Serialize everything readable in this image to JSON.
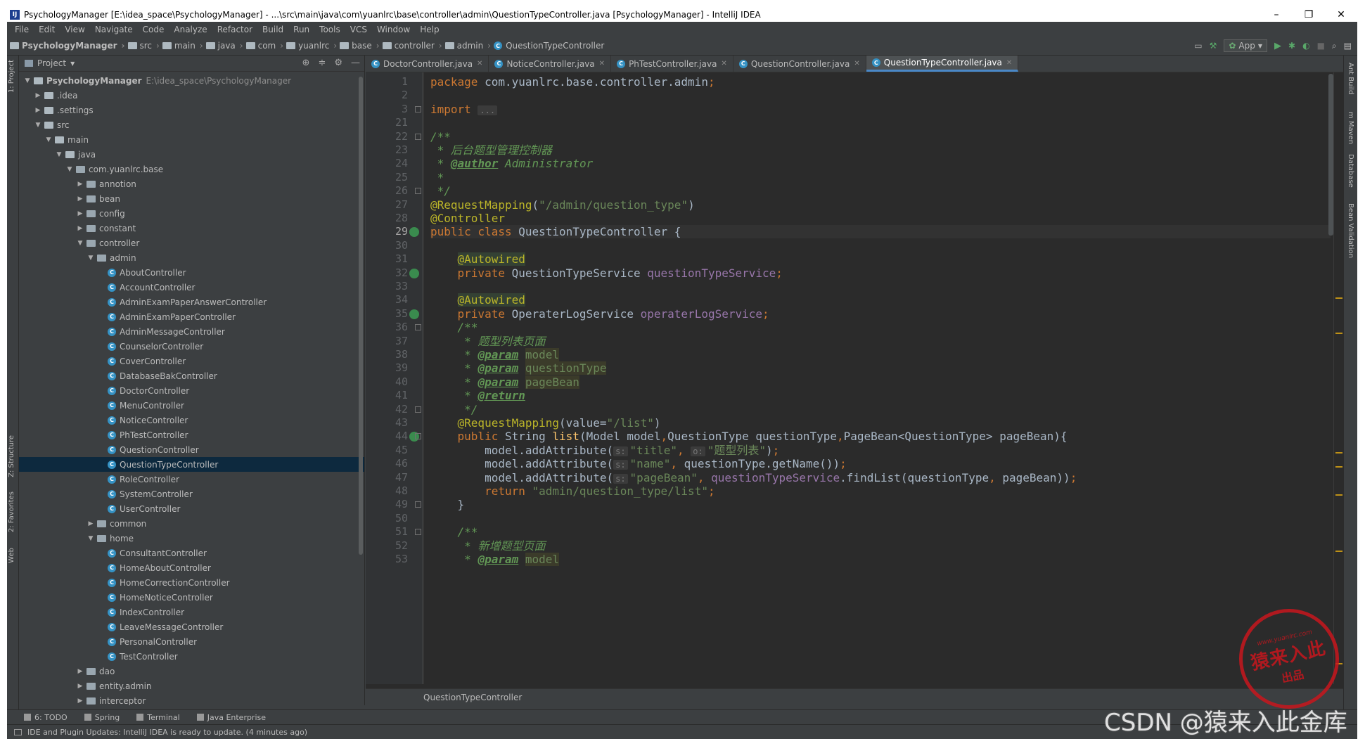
{
  "window": {
    "title": "PsychologyManager [E:\\idea_space\\PsychologyManager] - ...\\src\\main\\java\\com\\yuanlrc\\base\\controller\\admin\\QuestionTypeController.java [PsychologyManager] - IntelliJ IDEA",
    "controls": [
      "–",
      "❐",
      "✕"
    ]
  },
  "menu": [
    "File",
    "Edit",
    "View",
    "Navigate",
    "Code",
    "Analyze",
    "Refactor",
    "Build",
    "Run",
    "Tools",
    "VCS",
    "Window",
    "Help"
  ],
  "navbar": {
    "crumbs": [
      "PsychologyManager",
      "src",
      "main",
      "java",
      "com",
      "yuanlrc",
      "base",
      "controller",
      "admin"
    ],
    "current": "QuestionTypeController",
    "run_config": "App"
  },
  "left_strip": [
    "1: Project",
    "Z: Structure",
    "2: Favorites",
    "Web"
  ],
  "right_strip": [
    "Ant Build",
    "m Maven",
    "Database",
    "Bean Validation"
  ],
  "project": {
    "header": "Project",
    "tree": [
      {
        "label": "PsychologyManager",
        "path": "E:\\idea_space\\PsychologyManager",
        "depth": 0,
        "kind": "project",
        "open": true
      },
      {
        "label": ".idea",
        "depth": 1,
        "kind": "folder",
        "open": false
      },
      {
        "label": ".settings",
        "depth": 1,
        "kind": "folder",
        "open": false
      },
      {
        "label": "src",
        "depth": 1,
        "kind": "folder",
        "open": true
      },
      {
        "label": "main",
        "depth": 2,
        "kind": "folder",
        "open": true
      },
      {
        "label": "java",
        "depth": 3,
        "kind": "folder",
        "open": true
      },
      {
        "label": "com.yuanlrc.base",
        "depth": 4,
        "kind": "pkg",
        "open": true
      },
      {
        "label": "annotion",
        "depth": 5,
        "kind": "pkg",
        "open": false
      },
      {
        "label": "bean",
        "depth": 5,
        "kind": "pkg",
        "open": false
      },
      {
        "label": "config",
        "depth": 5,
        "kind": "pkg",
        "open": false
      },
      {
        "label": "constant",
        "depth": 5,
        "kind": "pkg",
        "open": false
      },
      {
        "label": "controller",
        "depth": 5,
        "kind": "pkg",
        "open": true
      },
      {
        "label": "admin",
        "depth": 6,
        "kind": "pkg",
        "open": true
      },
      {
        "label": "AboutController",
        "depth": 7,
        "kind": "class"
      },
      {
        "label": "AccountController",
        "depth": 7,
        "kind": "class"
      },
      {
        "label": "AdminExamPaperAnswerController",
        "depth": 7,
        "kind": "class"
      },
      {
        "label": "AdminExamPaperController",
        "depth": 7,
        "kind": "class"
      },
      {
        "label": "AdminMessageController",
        "depth": 7,
        "kind": "class"
      },
      {
        "label": "CounselorController",
        "depth": 7,
        "kind": "class"
      },
      {
        "label": "CoverController",
        "depth": 7,
        "kind": "class"
      },
      {
        "label": "DatabaseBakController",
        "depth": 7,
        "kind": "class"
      },
      {
        "label": "DoctorController",
        "depth": 7,
        "kind": "class"
      },
      {
        "label": "MenuController",
        "depth": 7,
        "kind": "class"
      },
      {
        "label": "NoticeController",
        "depth": 7,
        "kind": "class"
      },
      {
        "label": "PhTestController",
        "depth": 7,
        "kind": "class"
      },
      {
        "label": "QuestionController",
        "depth": 7,
        "kind": "class"
      },
      {
        "label": "QuestionTypeController",
        "depth": 7,
        "kind": "class",
        "selected": true
      },
      {
        "label": "RoleController",
        "depth": 7,
        "kind": "class"
      },
      {
        "label": "SystemController",
        "depth": 7,
        "kind": "class"
      },
      {
        "label": "UserController",
        "depth": 7,
        "kind": "class"
      },
      {
        "label": "common",
        "depth": 6,
        "kind": "pkg",
        "open": false
      },
      {
        "label": "home",
        "depth": 6,
        "kind": "pkg",
        "open": true
      },
      {
        "label": "ConsultantController",
        "depth": 7,
        "kind": "class"
      },
      {
        "label": "HomeAboutController",
        "depth": 7,
        "kind": "class"
      },
      {
        "label": "HomeCorrectionController",
        "depth": 7,
        "kind": "class"
      },
      {
        "label": "HomeNoticeController",
        "depth": 7,
        "kind": "class"
      },
      {
        "label": "IndexController",
        "depth": 7,
        "kind": "class"
      },
      {
        "label": "LeaveMessageController",
        "depth": 7,
        "kind": "class"
      },
      {
        "label": "PersonalController",
        "depth": 7,
        "kind": "class"
      },
      {
        "label": "TestController",
        "depth": 7,
        "kind": "class"
      },
      {
        "label": "dao",
        "depth": 5,
        "kind": "pkg",
        "open": false
      },
      {
        "label": "entity.admin",
        "depth": 5,
        "kind": "pkg",
        "open": false
      },
      {
        "label": "interceptor",
        "depth": 5,
        "kind": "pkg",
        "open": false
      }
    ]
  },
  "editor": {
    "tabs": [
      {
        "label": "DoctorController.java",
        "active": false
      },
      {
        "label": "NoticeController.java",
        "active": false
      },
      {
        "label": "PhTestController.java",
        "active": false
      },
      {
        "label": "QuestionController.java",
        "active": false
      },
      {
        "label": "QuestionTypeController.java",
        "active": true
      }
    ],
    "current_line": "29",
    "lines": [
      {
        "n": "1",
        "segs": [
          [
            "kw",
            "package "
          ],
          [
            "",
            "com.yuanlrc.base.controller.admin"
          ],
          [
            "kw",
            ";"
          ]
        ]
      },
      {
        "n": "2",
        "segs": []
      },
      {
        "n": "3",
        "segs": [
          [
            "kw",
            "import "
          ],
          [
            "hint",
            "..."
          ]
        ],
        "fold": true
      },
      {
        "n": "21",
        "segs": []
      },
      {
        "n": "22",
        "segs": [
          [
            "cmt",
            "/**"
          ]
        ],
        "fold": true
      },
      {
        "n": "23",
        "segs": [
          [
            "cmt",
            " * "
          ],
          [
            "cmtcn",
            "后台题型管理控制器"
          ]
        ]
      },
      {
        "n": "24",
        "segs": [
          [
            "cmt",
            " * "
          ],
          [
            "tag",
            "@author"
          ],
          [
            "cmt",
            " Administrator"
          ]
        ]
      },
      {
        "n": "25",
        "segs": [
          [
            "cmt",
            " *"
          ]
        ]
      },
      {
        "n": "26",
        "segs": [
          [
            "cmt",
            " */"
          ]
        ],
        "fold": true
      },
      {
        "n": "27",
        "segs": [
          [
            "ann",
            "@RequestMapping"
          ],
          [
            "",
            "("
          ],
          [
            "str",
            "\"/admin/question_type\""
          ],
          [
            "",
            ")"
          ]
        ]
      },
      {
        "n": "28",
        "segs": [
          [
            "ann",
            "@Controller"
          ]
        ]
      },
      {
        "n": "29",
        "segs": [
          [
            "kw",
            "public class "
          ],
          [
            "",
            "QuestionTypeController {"
          ]
        ],
        "mark": true
      },
      {
        "n": "30",
        "segs": []
      },
      {
        "n": "31",
        "segs": [
          [
            "",
            "    "
          ],
          [
            "ann hl",
            "@Autowired"
          ]
        ]
      },
      {
        "n": "32",
        "segs": [
          [
            "",
            "    "
          ],
          [
            "kw",
            "private "
          ],
          [
            "",
            "QuestionTypeService "
          ],
          [
            "field",
            "questionTypeService"
          ],
          [
            "kw",
            ";"
          ]
        ],
        "mark": true
      },
      {
        "n": "33",
        "segs": []
      },
      {
        "n": "34",
        "segs": [
          [
            "",
            "    "
          ],
          [
            "ann hl",
            "@Autowired"
          ]
        ]
      },
      {
        "n": "35",
        "segs": [
          [
            "",
            "    "
          ],
          [
            "kw",
            "private "
          ],
          [
            "",
            "OperaterLogService "
          ],
          [
            "field",
            "operaterLogService"
          ],
          [
            "kw",
            ";"
          ]
        ],
        "mark": true
      },
      {
        "n": "36",
        "segs": [
          [
            "cmt",
            "    /**"
          ]
        ],
        "fold": true
      },
      {
        "n": "37",
        "segs": [
          [
            "cmt",
            "     * "
          ],
          [
            "cmtcn",
            "题型列表页面"
          ]
        ]
      },
      {
        "n": "38",
        "segs": [
          [
            "cmt",
            "     * "
          ],
          [
            "tag",
            "@param"
          ],
          [
            "cmt",
            " "
          ],
          [
            "pname",
            "model"
          ]
        ]
      },
      {
        "n": "39",
        "segs": [
          [
            "cmt",
            "     * "
          ],
          [
            "tag",
            "@param"
          ],
          [
            "cmt",
            " "
          ],
          [
            "pname",
            "questionType"
          ]
        ]
      },
      {
        "n": "40",
        "segs": [
          [
            "cmt",
            "     * "
          ],
          [
            "tag",
            "@param"
          ],
          [
            "cmt",
            " "
          ],
          [
            "pname",
            "pageBean"
          ]
        ]
      },
      {
        "n": "41",
        "segs": [
          [
            "cmt",
            "     * "
          ],
          [
            "tag",
            "@return"
          ]
        ]
      },
      {
        "n": "42",
        "segs": [
          [
            "cmt",
            "     */"
          ]
        ],
        "fold": true
      },
      {
        "n": "43",
        "segs": [
          [
            "",
            "    "
          ],
          [
            "ann",
            "@RequestMapping"
          ],
          [
            "",
            "(value="
          ],
          [
            "str",
            "\"/list\""
          ],
          [
            "",
            ")"
          ]
        ]
      },
      {
        "n": "44",
        "segs": [
          [
            "",
            "    "
          ],
          [
            "kw",
            "public "
          ],
          [
            "",
            "String "
          ],
          [
            "meth",
            "list"
          ],
          [
            "",
            "(Model model"
          ],
          [
            "kw",
            ","
          ],
          [
            "",
            "QuestionType questionType"
          ],
          [
            "kw",
            ","
          ],
          [
            "",
            "PageBean<QuestionType> pageBean){"
          ]
        ],
        "mark": true,
        "fold": true
      },
      {
        "n": "45",
        "segs": [
          [
            "",
            "        model.addAttribute("
          ],
          [
            "hint",
            "s:"
          ],
          [
            "str",
            "\"title\""
          ],
          [
            "kw",
            ", "
          ],
          [
            "hint",
            "o:"
          ],
          [
            "str",
            "\"题型列表\""
          ],
          [
            "",
            ")"
          ],
          [
            "kw",
            ";"
          ]
        ]
      },
      {
        "n": "46",
        "segs": [
          [
            "",
            "        model.addAttribute("
          ],
          [
            "hint",
            "s:"
          ],
          [
            "str",
            "\"name\""
          ],
          [
            "kw",
            ", "
          ],
          [
            "",
            "questionType.getName())"
          ],
          [
            "kw",
            ";"
          ]
        ]
      },
      {
        "n": "47",
        "segs": [
          [
            "",
            "        model.addAttribute("
          ],
          [
            "hint",
            "s:"
          ],
          [
            "str",
            "\"pageBean\""
          ],
          [
            "kw",
            ", "
          ],
          [
            "field",
            "questionTypeService"
          ],
          [
            "",
            ".findList(questionType"
          ],
          [
            "kw",
            ", "
          ],
          [
            "",
            "pageBean))"
          ],
          [
            "kw",
            ";"
          ]
        ]
      },
      {
        "n": "48",
        "segs": [
          [
            "",
            "        "
          ],
          [
            "kw",
            "return "
          ],
          [
            "str",
            "\"admin/question_type/list\""
          ],
          [
            "kw",
            ";"
          ]
        ]
      },
      {
        "n": "49",
        "segs": [
          [
            "",
            "    }"
          ]
        ],
        "fold": true
      },
      {
        "n": "50",
        "segs": []
      },
      {
        "n": "51",
        "segs": [
          [
            "cmt",
            "    /**"
          ]
        ],
        "fold": true
      },
      {
        "n": "52",
        "segs": [
          [
            "cmt",
            "     * "
          ],
          [
            "cmtcn",
            "新增题型页面"
          ]
        ]
      },
      {
        "n": "53",
        "segs": [
          [
            "cmt",
            "     * "
          ],
          [
            "tag",
            "@param"
          ],
          [
            "cmt",
            " "
          ],
          [
            "pname",
            "model"
          ]
        ]
      }
    ],
    "bottom_breadcrumb": "QuestionTypeController"
  },
  "bottom_tools": [
    "6: TODO",
    "Spring",
    "Terminal",
    "Java Enterprise"
  ],
  "status": "IDE and Plugin Updates: IntelliJ IDEA is ready to update. (4 minutes ago)",
  "watermark": {
    "stamp_top": "www.yuanlrc.com",
    "stamp_main": "猿来入此",
    "stamp_bottom": "出品",
    "csdn": "CSDN @猿来入此金库"
  },
  "colors": {
    "accent": "#4a88c7",
    "bg_editor": "#2b2b2b",
    "bg_panel": "#3c3f41",
    "selection": "#0d293e"
  }
}
